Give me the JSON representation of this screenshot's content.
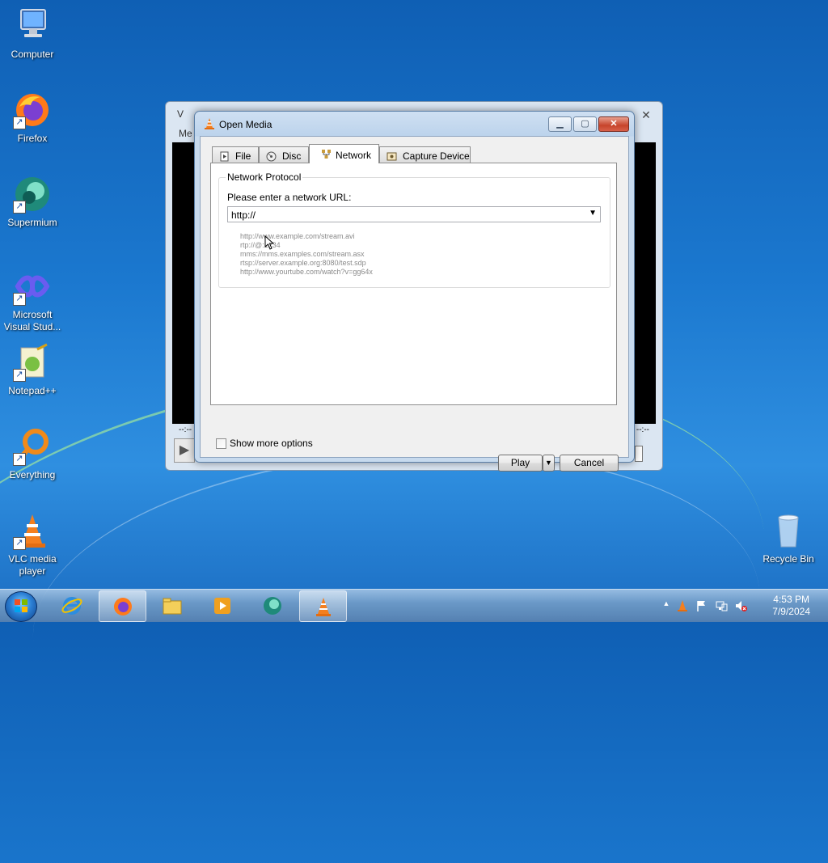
{
  "desktop": {
    "icons": [
      {
        "label": "Computer"
      },
      {
        "label": "Firefox"
      },
      {
        "label": "Supermium"
      },
      {
        "label": "Microsoft Visual Stud..."
      },
      {
        "label": "Notepad++"
      },
      {
        "label": "Everything"
      },
      {
        "label": "VLC media player"
      },
      {
        "label": "Recycle Bin"
      }
    ]
  },
  "vlc_main": {
    "title_fragment": "V",
    "menu_fragment": "Me",
    "time_left": "--:--",
    "time_right": "--:--"
  },
  "dialog": {
    "title": "Open Media",
    "window_buttons": {
      "minimize": "▁",
      "maximize": "▢",
      "close": "✕"
    },
    "tabs": [
      {
        "label": "File",
        "icon": "file-icon"
      },
      {
        "label": "Disc",
        "icon": "disc-icon"
      },
      {
        "label": "Network",
        "icon": "network-icon",
        "active": true
      },
      {
        "label": "Capture Device",
        "icon": "capture-device-icon"
      }
    ],
    "group_title": "Network Protocol",
    "prompt": "Please enter a network URL:",
    "url_value": "http://",
    "examples": [
      "http://www.example.com/stream.avi",
      "rtp://@:1234",
      "mms://mms.examples.com/stream.asx",
      "rtsp://server.example.org:8080/test.sdp",
      "http://www.yourtube.com/watch?v=gg64x"
    ],
    "show_more_options": "Show more options",
    "play_button": "Play",
    "cancel_button": "Cancel"
  },
  "taskbar": {
    "clock_time": "4:53 PM",
    "clock_date": "7/9/2024"
  }
}
